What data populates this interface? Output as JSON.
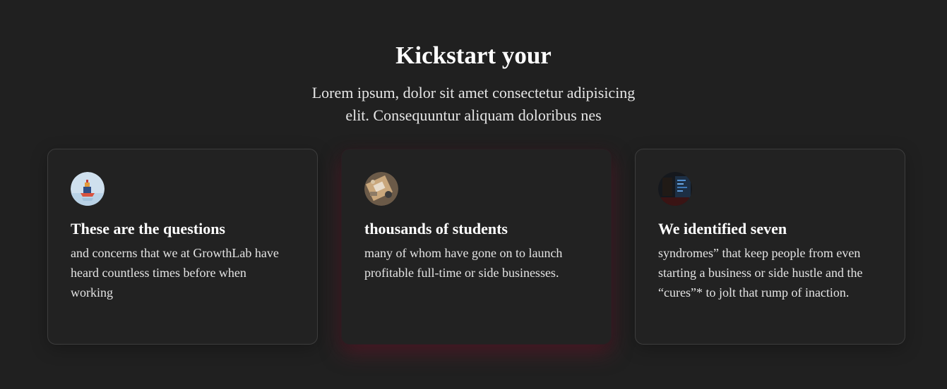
{
  "header": {
    "title": "Kickstart your",
    "subtitle_line1": "Lorem ipsum, dolor sit amet consectetur adipisicing",
    "subtitle_line2": "elit. Consequuntur aliquam doloribus nes"
  },
  "cards": [
    {
      "title": "These are the questions",
      "text": "and concerns that we at GrowthLab have heard countless times before when working",
      "avatar": "boat-illustration-avatar"
    },
    {
      "title": "thousands of students",
      "text": "many of whom have gone on to launch profitable full-time or side businesses.",
      "avatar": "workspace-desk-avatar"
    },
    {
      "title": "We identified seven",
      "text": "syndromes” that keep people from even starting a business or side hustle and the “cures”* to jolt that rump of inaction.",
      "avatar": "code-screen-avatar"
    }
  ],
  "colors": {
    "background": "#202020",
    "card_border": "#3d3d3d",
    "highlight_glow": "#6e192d"
  }
}
